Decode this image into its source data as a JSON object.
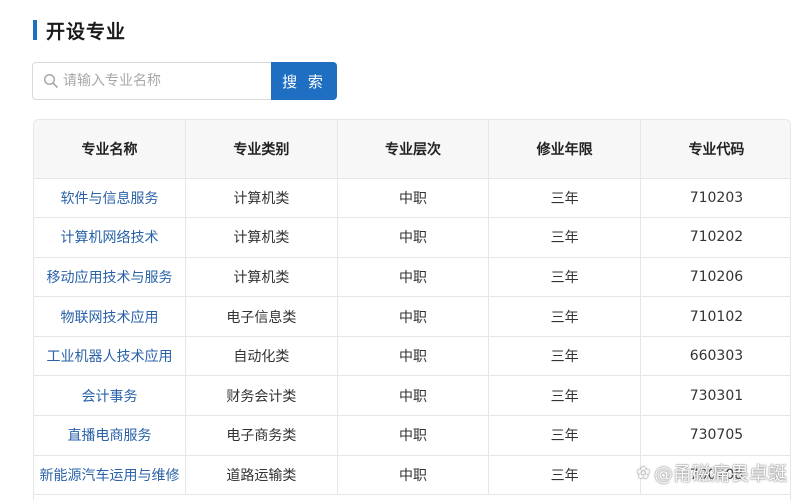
{
  "header": {
    "title": "开设专业"
  },
  "search": {
    "placeholder": "请输入专业名称",
    "value": "",
    "button_label": "搜 索"
  },
  "table": {
    "columns": [
      "专业名称",
      "专业类别",
      "专业层次",
      "修业年限",
      "专业代码"
    ],
    "rows": [
      {
        "name": "软件与信息服务",
        "category": "计算机类",
        "level": "中职",
        "years": "三年",
        "code": "710203"
      },
      {
        "name": "计算机网络技术",
        "category": "计算机类",
        "level": "中职",
        "years": "三年",
        "code": "710202"
      },
      {
        "name": "移动应用技术与服务",
        "category": "计算机类",
        "level": "中职",
        "years": "三年",
        "code": "710206"
      },
      {
        "name": "物联网技术应用",
        "category": "电子信息类",
        "level": "中职",
        "years": "三年",
        "code": "710102"
      },
      {
        "name": "工业机器人技术应用",
        "category": "自动化类",
        "level": "中职",
        "years": "三年",
        "code": "660303"
      },
      {
        "name": "会计事务",
        "category": "财务会计类",
        "level": "中职",
        "years": "三年",
        "code": "730301"
      },
      {
        "name": "直播电商服务",
        "category": "电子商务类",
        "level": "中职",
        "years": "三年",
        "code": "730705"
      },
      {
        "name": "新能源汽车运用与维修",
        "category": "道路运输类",
        "level": "中职",
        "years": "三年",
        "code": "700208"
      }
    ]
  },
  "watermark": {
    "text": "@甬磁痛畏卓蜓",
    "icon": "paw-icon"
  },
  "colors": {
    "accent": "#1e6fc2",
    "link": "#2a62a8",
    "header_bg": "#f7f7f7",
    "border": "#e6e6e6"
  }
}
